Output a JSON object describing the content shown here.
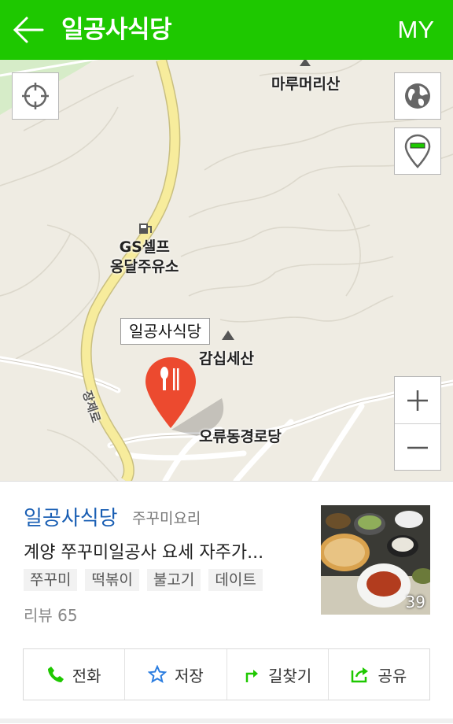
{
  "header": {
    "title": "일공사식당",
    "my_label": "MY"
  },
  "map": {
    "labels": {
      "mountain1": "마루머리산",
      "gas_line1": "GS셀프",
      "gas_line2": "옹달주유소",
      "mountain2": "감십세산",
      "senior": "오류동경로당",
      "road": "장제로"
    },
    "callout": "일공사식당"
  },
  "place": {
    "name": "일공사식당",
    "category": "주꾸미요리",
    "description": "계양 쭈꾸미일공사 요세 자주가...",
    "tags": [
      "쭈꾸미",
      "떡볶이",
      "불고기",
      "데이트"
    ],
    "review": "리뷰 65",
    "photo_count": "39"
  },
  "actions": {
    "call": "전화",
    "save": "저장",
    "route": "길찾기",
    "share": "공유"
  },
  "colors": {
    "brand": "#1ec800",
    "link": "#1a5fb4",
    "pin": "#ec4a2f"
  }
}
